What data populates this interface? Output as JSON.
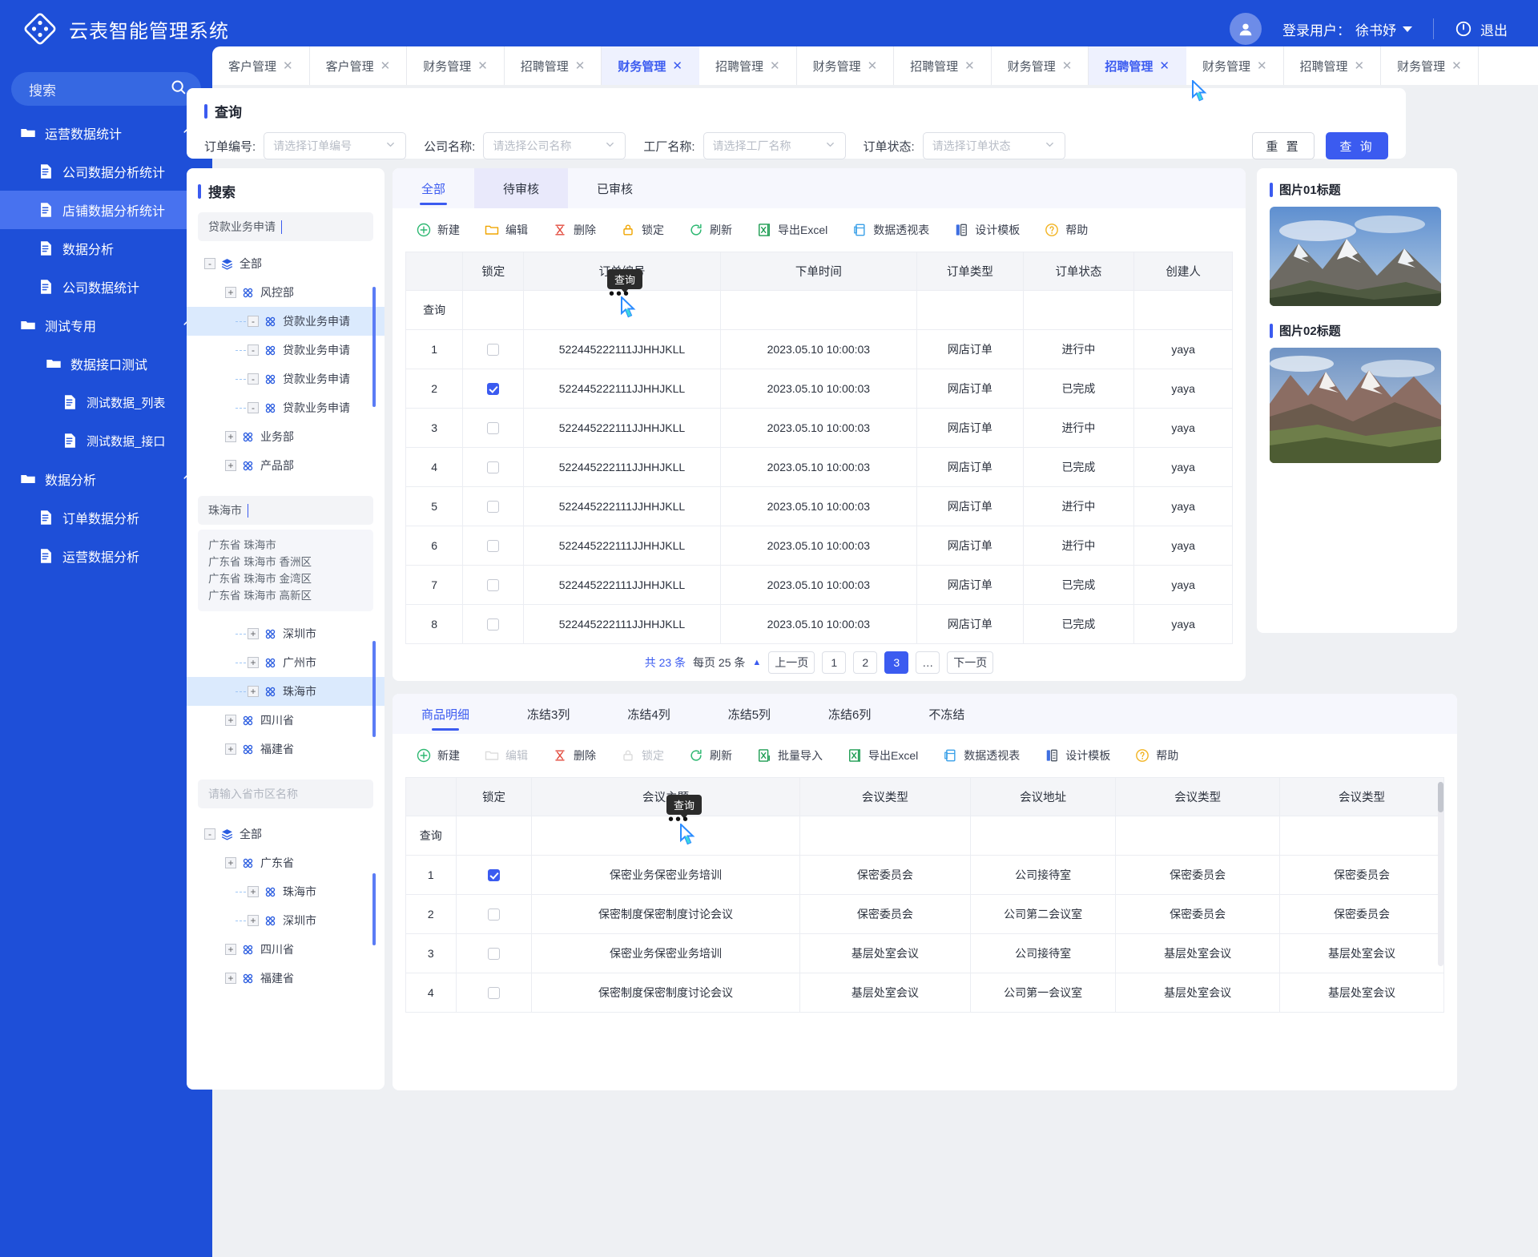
{
  "header": {
    "brand_title": "云表智能管理系统",
    "user_prefix": "登录用户：",
    "user_name": "徐书妤",
    "logout": "退出"
  },
  "sidebar": {
    "search_placeholder": "搜索",
    "items": [
      {
        "label": "运营数据统计",
        "level": 0,
        "icon": "folder-icon",
        "expanded": true,
        "active": false
      },
      {
        "label": "公司数据分析统计",
        "level": 1,
        "icon": "doc-icon",
        "active": false
      },
      {
        "label": "店铺数据分析统计",
        "level": 1,
        "icon": "doc-icon",
        "active": true
      },
      {
        "label": "数据分析",
        "level": 1,
        "icon": "doc-icon",
        "active": false
      },
      {
        "label": "公司数据统计",
        "level": 1,
        "icon": "doc-icon",
        "active": false
      },
      {
        "label": "测试专用",
        "level": 0,
        "icon": "folder-icon",
        "expanded": true,
        "active": false
      },
      {
        "label": "数据接口测试",
        "level": 2,
        "icon": "folder-icon",
        "active": false
      },
      {
        "label": "测试数据_列表",
        "level": 3,
        "icon": "doc-icon",
        "active": false
      },
      {
        "label": "测试数据_接口",
        "level": 3,
        "icon": "doc-icon",
        "active": false
      },
      {
        "label": "数据分析",
        "level": 0,
        "icon": "folder-icon",
        "expanded": true,
        "active": false
      },
      {
        "label": "订单数据分析",
        "level": 1,
        "icon": "doc-icon",
        "active": false
      },
      {
        "label": "运营数据分析",
        "level": 1,
        "icon": "doc-icon",
        "active": false
      }
    ]
  },
  "tabs": [
    {
      "label": "客户管理",
      "active": false
    },
    {
      "label": "客户管理",
      "active": false
    },
    {
      "label": "财务管理",
      "active": false
    },
    {
      "label": "招聘管理",
      "active": false
    },
    {
      "label": "财务管理",
      "active": true
    },
    {
      "label": "招聘管理",
      "active": false
    },
    {
      "label": "财务管理",
      "active": false
    },
    {
      "label": "招聘管理",
      "active": false
    },
    {
      "label": "财务管理",
      "active": false
    },
    {
      "label": "招聘管理",
      "active": true
    },
    {
      "label": "财务管理",
      "active": false
    },
    {
      "label": "招聘管理",
      "active": false
    },
    {
      "label": "财务管理",
      "active": false
    }
  ],
  "query": {
    "title": "查询",
    "fields": [
      {
        "label": "订单编号:",
        "placeholder": "请选择订单编号"
      },
      {
        "label": "公司名称:",
        "placeholder": "请选择公司名称"
      },
      {
        "label": "工厂名称:",
        "placeholder": "请选择工厂名称"
      },
      {
        "label": "订单状态:",
        "placeholder": "请选择订单状态"
      }
    ],
    "reset_label": "重 置",
    "query_label": "查 询"
  },
  "tree_panel": {
    "title": "搜索",
    "search1_value": "贷款业务申请",
    "tree1": [
      {
        "label": "全部",
        "level": 0,
        "exp": "-",
        "icon": "layers-icon",
        "sel": false
      },
      {
        "label": "风控部",
        "level": 1,
        "exp": "+",
        "icon": "grid-icon",
        "sel": false
      },
      {
        "label": "贷款业务申请",
        "level": 2,
        "exp": "-",
        "icon": "grid-icon",
        "sel": true
      },
      {
        "label": "贷款业务申请",
        "level": 2,
        "exp": "-",
        "icon": "grid-icon",
        "sel": false
      },
      {
        "label": "贷款业务申请",
        "level": 2,
        "exp": "-",
        "icon": "grid-icon",
        "sel": false
      },
      {
        "label": "贷款业务申请",
        "level": 2,
        "exp": "-",
        "icon": "grid-icon",
        "sel": false
      },
      {
        "label": "业务部",
        "level": 1,
        "exp": "+",
        "icon": "grid-icon",
        "sel": false
      },
      {
        "label": "产品部",
        "level": 1,
        "exp": "+",
        "icon": "grid-icon",
        "sel": false
      }
    ],
    "search2_value": "珠海市",
    "suggestions": [
      "广东省 珠海市",
      "广东省 珠海市 香洲区",
      "广东省 珠海市 金湾区",
      "广东省 珠海市 高新区"
    ],
    "tree2": [
      {
        "label": "深圳市",
        "level": 2,
        "exp": "+",
        "icon": "grid-icon",
        "sel": false
      },
      {
        "label": "广州市",
        "level": 2,
        "exp": "+",
        "icon": "grid-icon",
        "sel": false
      },
      {
        "label": "珠海市",
        "level": 2,
        "exp": "+",
        "icon": "grid-icon",
        "sel": true
      },
      {
        "label": "四川省",
        "level": 1,
        "exp": "+",
        "icon": "grid-icon",
        "sel": false
      },
      {
        "label": "福建省",
        "level": 1,
        "exp": "+",
        "icon": "grid-icon",
        "sel": false
      }
    ],
    "search3_placeholder": "请输入省市区名称",
    "tree3": [
      {
        "label": "全部",
        "level": 0,
        "exp": "-",
        "icon": "layers-icon",
        "sel": false
      },
      {
        "label": "广东省",
        "level": 1,
        "exp": "+",
        "icon": "grid-icon",
        "sel": false
      },
      {
        "label": "珠海市",
        "level": 2,
        "exp": "+",
        "icon": "grid-icon",
        "sel": false
      },
      {
        "label": "深圳市",
        "level": 2,
        "exp": "+",
        "icon": "grid-icon",
        "sel": false
      },
      {
        "label": "四川省",
        "level": 1,
        "exp": "+",
        "icon": "grid-icon",
        "sel": false
      },
      {
        "label": "福建省",
        "level": 1,
        "exp": "+",
        "icon": "grid-icon",
        "sel": false
      }
    ]
  },
  "main_panel": {
    "tabs": [
      {
        "label": "全部",
        "active": true,
        "hover": false
      },
      {
        "label": "待审核",
        "active": false,
        "hover": true
      },
      {
        "label": "已审核",
        "active": false,
        "hover": false
      }
    ],
    "toolbar": [
      {
        "label": "新建",
        "icon": "plus-circle-icon",
        "disabled": false
      },
      {
        "label": "编辑",
        "icon": "folder-open-icon",
        "disabled": false
      },
      {
        "label": "删除",
        "icon": "delete-icon",
        "disabled": false
      },
      {
        "label": "锁定",
        "icon": "lock-icon",
        "disabled": false
      },
      {
        "label": "刷新",
        "icon": "refresh-icon",
        "disabled": false
      },
      {
        "label": "导出Excel",
        "icon": "excel-icon",
        "disabled": false
      },
      {
        "label": "数据透视表",
        "icon": "pivot-icon",
        "disabled": false
      },
      {
        "label": "设计模板",
        "icon": "template-icon",
        "disabled": false
      },
      {
        "label": "帮助",
        "icon": "help-icon",
        "disabled": false
      }
    ],
    "columns": [
      "",
      "锁定",
      "订单编号",
      "下单时间",
      "订单类型",
      "订单状态",
      "创建人"
    ],
    "filter_row_label": "查询",
    "tooltip": "查询",
    "rows": [
      {
        "idx": "1",
        "locked": false,
        "order_no": "522445222111JJHHJKLL",
        "time": "2023.05.10 10:00:03",
        "type": "网店订单",
        "status": "进行中",
        "status_kind": "prog",
        "creator": "yaya"
      },
      {
        "idx": "2",
        "locked": true,
        "order_no": "522445222111JJHHJKLL",
        "time": "2023.05.10 10:00:03",
        "type": "网店订单",
        "status": "已完成",
        "status_kind": "done",
        "creator": "yaya"
      },
      {
        "idx": "3",
        "locked": false,
        "order_no": "522445222111JJHHJKLL",
        "time": "2023.05.10 10:00:03",
        "type": "网店订单",
        "status": "进行中",
        "status_kind": "prog",
        "creator": "yaya"
      },
      {
        "idx": "4",
        "locked": false,
        "order_no": "522445222111JJHHJKLL",
        "time": "2023.05.10 10:00:03",
        "type": "网店订单",
        "status": "已完成",
        "status_kind": "done",
        "creator": "yaya"
      },
      {
        "idx": "5",
        "locked": false,
        "order_no": "522445222111JJHHJKLL",
        "time": "2023.05.10 10:00:03",
        "type": "网店订单",
        "status": "进行中",
        "status_kind": "prog",
        "creator": "yaya"
      },
      {
        "idx": "6",
        "locked": false,
        "order_no": "522445222111JJHHJKLL",
        "time": "2023.05.10 10:00:03",
        "type": "网店订单",
        "status": "进行中",
        "status_kind": "prog",
        "creator": "yaya"
      },
      {
        "idx": "7",
        "locked": false,
        "order_no": "522445222111JJHHJKLL",
        "time": "2023.05.10 10:00:03",
        "type": "网店订单",
        "status": "已完成",
        "status_kind": "done",
        "creator": "yaya"
      },
      {
        "idx": "8",
        "locked": false,
        "order_no": "522445222111JJHHJKLL",
        "time": "2023.05.10 10:00:03",
        "type": "网店订单",
        "status": "已完成",
        "status_kind": "done",
        "creator": "yaya"
      }
    ],
    "pagination": {
      "total_text": "共 23 条",
      "per_page_text": "每页 25 条",
      "prev": "上一页",
      "pages": [
        "1",
        "2",
        "3",
        "…"
      ],
      "current": "3",
      "next": "下一页"
    }
  },
  "images_panel": {
    "items": [
      {
        "title": "图片01标题",
        "kind": "mountain-snow"
      },
      {
        "title": "图片02标题",
        "kind": "mountain-canyon"
      }
    ]
  },
  "bottom_panel": {
    "tabs": [
      {
        "label": "商品明细",
        "active": true
      },
      {
        "label": "冻结3列",
        "active": false
      },
      {
        "label": "冻结4列",
        "active": false
      },
      {
        "label": "冻结5列",
        "active": false
      },
      {
        "label": "冻结6列",
        "active": false
      },
      {
        "label": "不冻结",
        "active": false
      }
    ],
    "toolbar": [
      {
        "label": "新建",
        "icon": "plus-circle-icon",
        "disabled": false
      },
      {
        "label": "编辑",
        "icon": "folder-open-icon",
        "disabled": true
      },
      {
        "label": "删除",
        "icon": "delete-icon",
        "disabled": false
      },
      {
        "label": "锁定",
        "icon": "lock-icon",
        "disabled": true
      },
      {
        "label": "刷新",
        "icon": "refresh-icon",
        "disabled": false
      },
      {
        "label": "批量导入",
        "icon": "excel-import-icon",
        "disabled": false
      },
      {
        "label": "导出Excel",
        "icon": "excel-icon",
        "disabled": false
      },
      {
        "label": "数据透视表",
        "icon": "pivot-icon",
        "disabled": false
      },
      {
        "label": "设计模板",
        "icon": "template-icon",
        "disabled": false
      },
      {
        "label": "帮助",
        "icon": "help-icon",
        "disabled": false
      }
    ],
    "columns": [
      "",
      "锁定",
      "会议主题",
      "会议类型",
      "会议地址",
      "会议类型",
      "会议类型"
    ],
    "filter_row_label": "查询",
    "tooltip": "查询",
    "rows": [
      {
        "idx": "1",
        "locked": true,
        "topic": "保密业务保密业务培训",
        "mtype": "保密委员会",
        "addr": "公司接待室",
        "mtype2": "保密委员会",
        "mtype3": "保密委员会"
      },
      {
        "idx": "2",
        "locked": false,
        "topic": "保密制度保密制度讨论会议",
        "mtype": "保密委员会",
        "addr": "公司第二会议室",
        "mtype2": "保密委员会",
        "mtype3": "保密委员会"
      },
      {
        "idx": "3",
        "locked": false,
        "topic": "保密业务保密业务培训",
        "mtype": "基层处室会议",
        "addr": "公司接待室",
        "mtype2": "基层处室会议",
        "mtype3": "基层处室会议"
      },
      {
        "idx": "4",
        "locked": false,
        "topic": "保密制度保密制度讨论会议",
        "mtype": "基层处室会议",
        "addr": "公司第一会议室",
        "mtype2": "基层处室会议",
        "mtype3": "基层处室会议"
      }
    ]
  },
  "colors": {
    "brand_blue": "#1e4fd8",
    "accent": "#3b5bf0",
    "status_progress": "#3b5bf0",
    "status_done": "#22a06b"
  }
}
